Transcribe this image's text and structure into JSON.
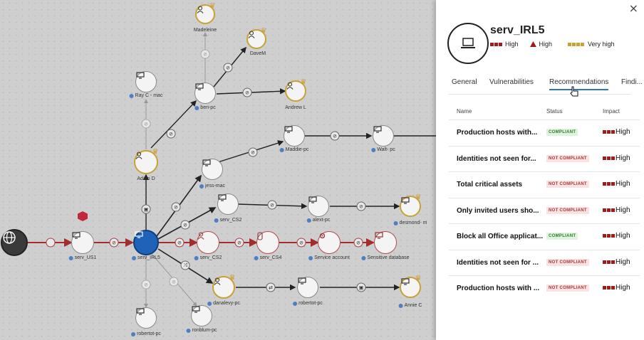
{
  "graph": {
    "nodes": [
      {
        "id": "madeleine",
        "label": "Madeleine"
      },
      {
        "id": "davem",
        "label": "DaveM"
      },
      {
        "id": "rayc",
        "label": "Ray C - mac"
      },
      {
        "id": "benpc",
        "label": "ben-pc"
      },
      {
        "id": "andrewl",
        "label": "Andrew L"
      },
      {
        "id": "maddiepc",
        "label": "Maddie-pc"
      },
      {
        "id": "waltpc",
        "label": "Walt- pc"
      },
      {
        "id": "adamd",
        "label": "Adam D"
      },
      {
        "id": "jessmac",
        "label": "jess-mac"
      },
      {
        "id": "servcs2a",
        "label": "serv_CS2"
      },
      {
        "id": "alextpc",
        "label": "alext-pc"
      },
      {
        "id": "desmond",
        "label": "desmond- m"
      },
      {
        "id": "servus1",
        "label": "serv_US1"
      },
      {
        "id": "servirl5",
        "label": "serv_IRL5"
      },
      {
        "id": "servcs2b",
        "label": "serv_CS2"
      },
      {
        "id": "servcs4",
        "label": "serv_CS4"
      },
      {
        "id": "svcacct",
        "label": "Service account"
      },
      {
        "id": "sensdb",
        "label": "Sensitive database"
      },
      {
        "id": "danalevy",
        "label": "danalevy-pc"
      },
      {
        "id": "robertotpc2",
        "label": "robertot-pc"
      },
      {
        "id": "anniec",
        "label": "Annie C"
      },
      {
        "id": "robertotpc1",
        "label": "robertot-pc"
      },
      {
        "id": "ronblum",
        "label": "ronblum-pc"
      }
    ]
  },
  "panel": {
    "close_icon": "×",
    "title": "serv_IRL5",
    "badges": [
      {
        "text": "High",
        "color": "#a01c1c",
        "kind": "squares"
      },
      {
        "text": "High",
        "color": "#a01c1c",
        "kind": "triangle"
      },
      {
        "text": "Very high",
        "color": "#c9a137",
        "kind": "squares4"
      }
    ],
    "tabs": [
      "General",
      "Vulnerabilities",
      "Recommendations",
      "Findi..."
    ],
    "active_tab": "Recommendations",
    "columns": {
      "name": "Name",
      "status": "Status",
      "impact": "Impact"
    },
    "rows": [
      {
        "name": "Production hosts with...",
        "status": "COMPLIANT",
        "status_kind": "ok",
        "impact": "High"
      },
      {
        "name": "Identities not seen for...",
        "status": "NOT COMPLIANT",
        "status_kind": "bad",
        "impact": "High"
      },
      {
        "name": "Total critical assets",
        "status": "NOT COMPLIANT",
        "status_kind": "bad",
        "impact": "High"
      },
      {
        "name": "Only invited users sho...",
        "status": "NOT COMPLIANT",
        "status_kind": "bad",
        "impact": "High"
      },
      {
        "name": "Block all Office applicat...",
        "status": "COMPLIANT",
        "status_kind": "ok",
        "impact": "High"
      },
      {
        "name": "Identities not seen for ...",
        "status": "NOT COMPLIANT",
        "status_kind": "bad",
        "impact": "High"
      },
      {
        "name": "Production hosts with ...",
        "status": "NOT COMPLIANT",
        "status_kind": "bad",
        "impact": "High"
      }
    ],
    "colors": {
      "accent": "#2b77c4",
      "impact": "#a01c1c",
      "gold": "#c9a137"
    }
  }
}
